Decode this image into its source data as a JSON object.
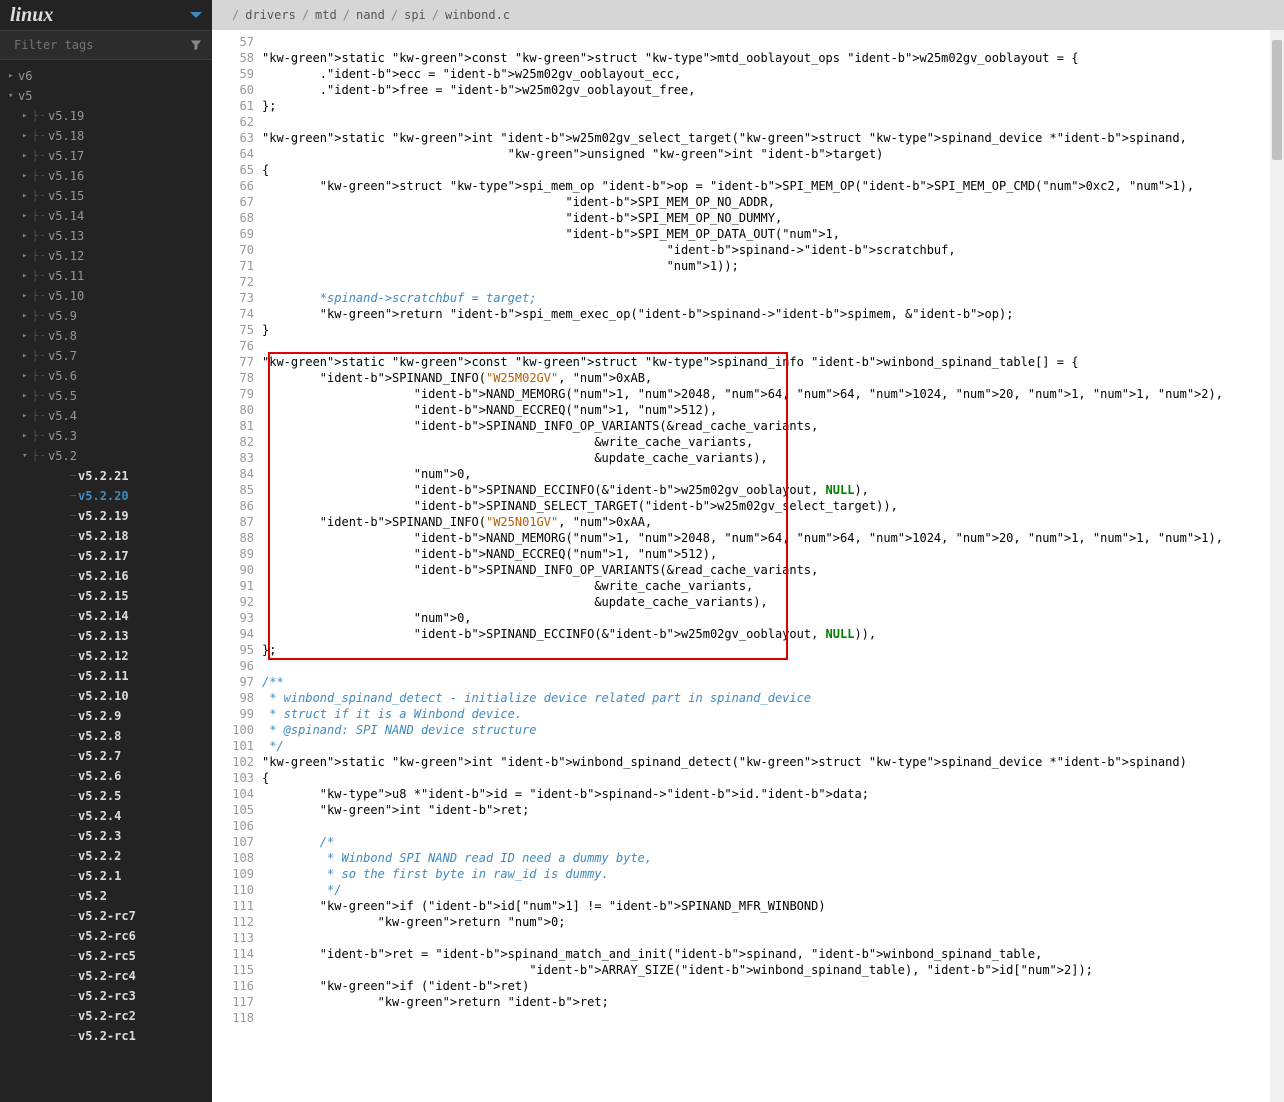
{
  "app": {
    "title": "linux"
  },
  "filter": {
    "placeholder": "Filter tags"
  },
  "breadcrumb": [
    "drivers",
    "mtd",
    "nand",
    "spi",
    "winbond.c"
  ],
  "tree": {
    "top": [
      {
        "label": "v6",
        "exp": "▸",
        "lv": 0
      },
      {
        "label": "v5",
        "exp": "▾",
        "lv": 0
      }
    ],
    "v5_sub": [
      "v5.19",
      "v5.18",
      "v5.17",
      "v5.16",
      "v5.15",
      "v5.14",
      "v5.13",
      "v5.12",
      "v5.11",
      "v5.10",
      "v5.9",
      "v5.8",
      "v5.7",
      "v5.6",
      "v5.5",
      "v5.4",
      "v5.3"
    ],
    "v52_label": "v5.2",
    "v52_sub": [
      "v5.2.21",
      "v5.2.20",
      "v5.2.19",
      "v5.2.18",
      "v5.2.17",
      "v5.2.16",
      "v5.2.15",
      "v5.2.14",
      "v5.2.13",
      "v5.2.12",
      "v5.2.11",
      "v5.2.10",
      "v5.2.9",
      "v5.2.8",
      "v5.2.7",
      "v5.2.6",
      "v5.2.5",
      "v5.2.4",
      "v5.2.3",
      "v5.2.2",
      "v5.2.1",
      "v5.2",
      "v5.2-rc7",
      "v5.2-rc6",
      "v5.2-rc5",
      "v5.2-rc4",
      "v5.2-rc3",
      "v5.2-rc2",
      "v5.2-rc1"
    ],
    "selected": "v5.2.20"
  },
  "code": {
    "first_line": 57,
    "highlight": {
      "start": 77,
      "end": 96
    },
    "lines": [
      "",
      "static const struct mtd_ooblayout_ops w25m02gv_ooblayout = {",
      "        .ecc = w25m02gv_ooblayout_ecc,",
      "        .free = w25m02gv_ooblayout_free,",
      "};",
      "",
      "static int w25m02gv_select_target(struct spinand_device *spinand,",
      "                                  unsigned int target)",
      "{",
      "        struct spi_mem_op op = SPI_MEM_OP(SPI_MEM_OP_CMD(0xc2, 1),",
      "                                          SPI_MEM_OP_NO_ADDR,",
      "                                          SPI_MEM_OP_NO_DUMMY,",
      "                                          SPI_MEM_OP_DATA_OUT(1,",
      "                                                        spinand->scratchbuf,",
      "                                                        1));",
      "",
      "        *spinand->scratchbuf = target;",
      "        return spi_mem_exec_op(spinand->spimem, &op);",
      "}",
      "",
      "static const struct spinand_info winbond_spinand_table[] = {",
      "        SPINAND_INFO(\"W25M02GV\", 0xAB,",
      "                     NAND_MEMORG(1, 2048, 64, 64, 1024, 20, 1, 1, 2),",
      "                     NAND_ECCREQ(1, 512),",
      "                     SPINAND_INFO_OP_VARIANTS(&read_cache_variants,",
      "                                              &write_cache_variants,",
      "                                              &update_cache_variants),",
      "                     0,",
      "                     SPINAND_ECCINFO(&w25m02gv_ooblayout, NULL),",
      "                     SPINAND_SELECT_TARGET(w25m02gv_select_target)),",
      "        SPINAND_INFO(\"W25N01GV\", 0xAA,",
      "                     NAND_MEMORG(1, 2048, 64, 64, 1024, 20, 1, 1, 1),",
      "                     NAND_ECCREQ(1, 512),",
      "                     SPINAND_INFO_OP_VARIANTS(&read_cache_variants,",
      "                                              &write_cache_variants,",
      "                                              &update_cache_variants),",
      "                     0,",
      "                     SPINAND_ECCINFO(&w25m02gv_ooblayout, NULL)),",
      "};",
      "",
      "/**",
      " * winbond_spinand_detect - initialize device related part in spinand_device",
      " * struct if it is a Winbond device.",
      " * @spinand: SPI NAND device structure",
      " */",
      "static int winbond_spinand_detect(struct spinand_device *spinand)",
      "{",
      "        u8 *id = spinand->id.data;",
      "        int ret;",
      "",
      "        /*",
      "         * Winbond SPI NAND read ID need a dummy byte,",
      "         * so the first byte in raw_id is dummy.",
      "         */",
      "        if (id[1] != SPINAND_MFR_WINBOND)",
      "                return 0;",
      "",
      "        ret = spinand_match_and_init(spinand, winbond_spinand_table,",
      "                                     ARRAY_SIZE(winbond_spinand_table), id[2]);",
      "        if (ret)",
      "                return ret;",
      ""
    ]
  }
}
